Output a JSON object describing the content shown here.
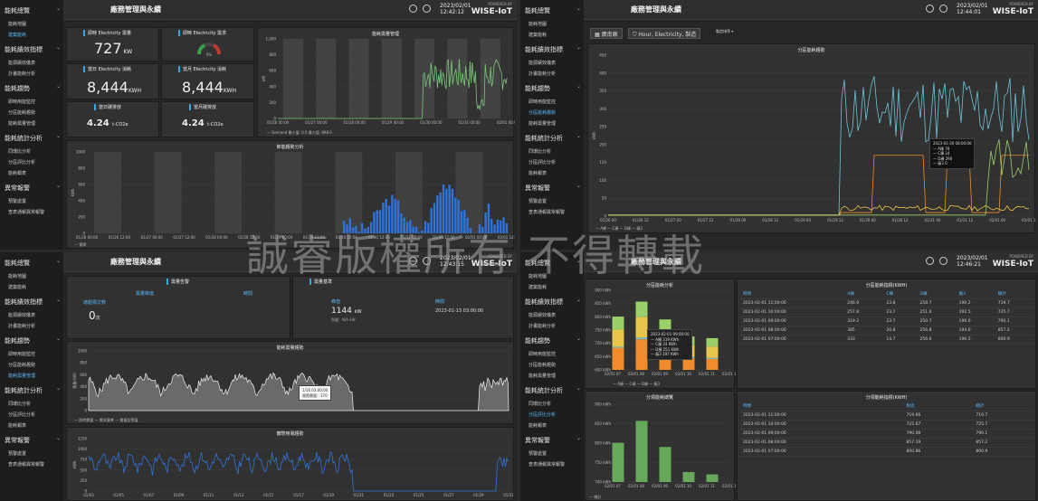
{
  "app": {
    "title": "廠務管理與永續",
    "powered": "POWERED BY",
    "brand": "WISE-IoT"
  },
  "watermark": "誠睿版權所有 不得轉載",
  "sidebar": {
    "sec1": "能耗總覽",
    "s1a": "能耗地圖",
    "s1b": "建築能耗",
    "sec2": "能耗績效指標",
    "s2a": "能源績效儀表",
    "s2b": "計畫能耗分析",
    "sec3": "能耗趨勢",
    "s3a": "即時用能監控",
    "s3b": "分區能耗趨勢",
    "s3c": "能耗需量管理",
    "sec4": "能耗統計分析",
    "s4a": "同環比分析",
    "s4b": "分區評比分析",
    "s4c": "能耗報表",
    "sec5": "異常報警",
    "s5a": "預警處置",
    "s5b": "查表通報異常報警"
  },
  "q1": {
    "date": "2023/02/01",
    "time": "12:42:12",
    "c1": {
      "title": "即時 Electricity 需量",
      "value": "727",
      "unit": "KW"
    },
    "c2": {
      "title": "即時 Electricity 需求",
      "gauge": "0%"
    },
    "c3": {
      "title": "當日 Electricity 消耗",
      "value": "8,444",
      "unit": "KWH"
    },
    "c4": {
      "title": "當月 Electricity 消耗",
      "value": "8,444",
      "unit": "KWH"
    },
    "c5": {
      "title": "當日碳排放",
      "value": "4.24",
      "unit": "t-CO2e"
    },
    "c6": {
      "title": "當月碳排放",
      "value": "4.24",
      "unit": "t-CO2e"
    },
    "demand": {
      "title": "能耗需量管理",
      "ylab": "kW",
      "legend": "— Demand  最小值: 0.0  最大值: 898.0",
      "x": [
        "01/26 00:00",
        "01/27 00:00",
        "01/28 00:00",
        "01/29 00:00",
        "01/30 00:00",
        "01/31 00:00",
        "02/01 00:00"
      ],
      "y": [
        "1,000",
        "800",
        "600",
        "400",
        "200",
        "0"
      ]
    },
    "trend": {
      "title": "節能趨勢分析",
      "ylab": "kWh",
      "legend": "— 實際",
      "x": [
        "01/26 00:00",
        "01/26 12:00",
        "01/27 00:00",
        "01/27 12:00",
        "01/28 00:00",
        "01/28 12:00",
        "01/29 00:00",
        "01/29 12:00",
        "01/30 00:00",
        "01/30 12:00",
        "01/31 00:00",
        "01/31 12:00",
        "02/01 00:00",
        "02/01 12:00"
      ],
      "y": [
        "1000",
        "800",
        "600",
        "400",
        "200",
        "0"
      ]
    }
  },
  "q2": {
    "date": "2023/02/01",
    "time": "12:44:01",
    "filter1": "廣南廠",
    "filter2": "Hour, Electricity, 製造",
    "filter3": "製造排序 ▾",
    "chart": {
      "title": "分區能耗趨勢",
      "ylab": "kWh",
      "y": [
        "450",
        "400",
        "350",
        "300",
        "250",
        "200",
        "150",
        "100",
        "50",
        "0"
      ],
      "x": [
        "01/26 00",
        "01/26 12",
        "01/27 00",
        "01/27 12",
        "01/28 00",
        "01/28 12",
        "01/29 00",
        "01/29 12",
        "01/30 00",
        "01/30 12",
        "01/31 00",
        "01/31 12",
        "02/01 00",
        "02/01 12"
      ],
      "legend": "— A棟  — C棟  — D棟  — 廠3"
    },
    "tip": [
      "2023-01-30 08:00:00",
      "— A棟 78",
      "— C棟 24",
      "— D棟 290",
      "— 廠3 0"
    ]
  },
  "q3": {
    "date": "2023/02/01",
    "time": "12:43:15",
    "alarm": {
      "title": "需量告警",
      "col1": "總超標次數",
      "col2": "需量峰值",
      "col3": "時間",
      "count": "0",
      "unit": "次"
    },
    "basis": {
      "title": "需量基準",
      "col1": "峰值",
      "col2": "時間",
      "peak": "1144",
      "unit": "kW",
      "sub": "負載：N/A kW",
      "time": "2023-01-13 03:00:00"
    },
    "demand": {
      "title": "能耗需量趨勢",
      "ylab": "需量(kW)",
      "y": [
        "1000",
        "800",
        "600",
        "400",
        "200",
        "0"
      ],
      "legend": "— 即時需量  — 需求基準  — 需量告警值",
      "tip1": "1/16 03:00:00",
      "tip2": "實際需量：370"
    },
    "power": {
      "title": "實際用電趨勢",
      "ylab": "kWh",
      "y": [
        "1250",
        "1000",
        "750",
        "500",
        "250",
        "0"
      ],
      "x": [
        "01/03",
        "01/05",
        "01/07",
        "01/09",
        "01/11",
        "01/13",
        "01/15",
        "01/17",
        "01/19",
        "01/21",
        "01/23",
        "01/25",
        "01/27",
        "01/29",
        "01/31"
      ]
    }
  },
  "q4": {
    "date": "2023/02/01",
    "time": "12:46:21",
    "stack": {
      "title": "分區能耗分析",
      "y": [
        "900 kWh",
        "850 kWh",
        "800 kWh",
        "750 kWh",
        "700 kWh",
        "650 kWh",
        "600 kWh"
      ],
      "x": [
        "02/01 07",
        "02/01 08",
        "02/01 09",
        "02/01 10",
        "02/01 11",
        "02/01 12"
      ],
      "legend": "— A棟  — C棟  — D棟  — 廠3",
      "tip": [
        "2023-02-01 09:00:00",
        "— A棟 319 KWh",
        "— C棟 24 KWh",
        "— D棟 251 KWh",
        "— 廠3 197 KWh"
      ]
    },
    "table1": {
      "title": "分區能耗指標(KWH)",
      "head": [
        "時間",
        "A棟",
        "C棟",
        "D棟",
        "廠3",
        "總計"
      ],
      "rows": [
        [
          "2023-02-01 11:00:00",
          "246.9",
          "23.8",
          "258.7",
          "190.2",
          "719.7"
        ],
        [
          "2023-02-01 10:00:00",
          "257.8",
          "23.7",
          "251.6",
          "192.5",
          "725.7"
        ],
        [
          "2023-02-01 09:00:00",
          "319.2",
          "23.7",
          "250.7",
          "196.6",
          "790.1"
        ],
        [
          "2023-02-01 08:00:00",
          "385",
          "20.8",
          "256.8",
          "194.6",
          "857.2"
        ],
        [
          "2023-02-01 07:00:00",
          "333",
          "14.7",
          "256.6",
          "196.5",
          "800.9"
        ]
      ]
    },
    "total": {
      "title": "分項能耗總覽",
      "y": [
        "900 kWh",
        "850 kWh",
        "800 kWh",
        "750 kWh",
        "700 kWh"
      ],
      "x": [
        "02/01 07",
        "02/01 08",
        "02/01 09",
        "02/01 10",
        "02/01 11",
        "02/01 12"
      ],
      "legend": "— 總計"
    },
    "table2": {
      "title": "分項能耗指標(KWH)",
      "head": [
        "時間",
        "製造",
        "總計"
      ],
      "rows": [
        [
          "2023-02-01 11:00:00",
          "719.66",
          "719.7"
        ],
        [
          "2023-02-01 10:00:00",
          "725.67",
          "725.7"
        ],
        [
          "2023-02-01 09:00:00",
          "790.08",
          "790.1"
        ],
        [
          "2023-02-01 08:00:00",
          "857.19",
          "857.2"
        ],
        [
          "2023-02-01 07:00:00",
          "800.86",
          "800.9"
        ]
      ]
    }
  }
}
